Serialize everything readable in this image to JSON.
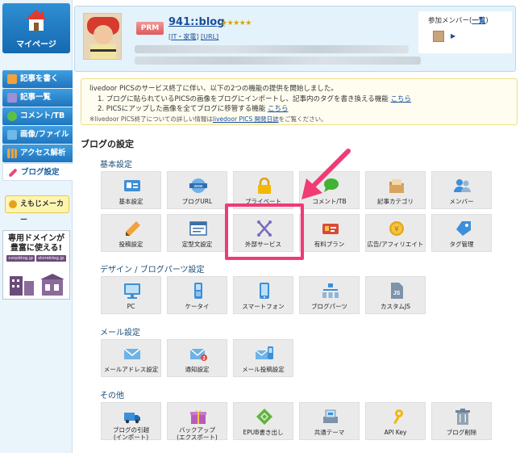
{
  "sidebar": {
    "mypage_label": "マイページ",
    "items": [
      {
        "label": "記事を書く",
        "icon": "pencil-icon",
        "color": "#f2a13b"
      },
      {
        "label": "記事一覧",
        "icon": "document-icon",
        "color": "#9e8fd6"
      },
      {
        "label": "コメント/TB",
        "icon": "chat-bubble-icon",
        "color": "#5cc046"
      },
      {
        "label": "画像/ファイル",
        "icon": "image-icon",
        "color": "#6fb8e8"
      },
      {
        "label": "アクセス解析",
        "icon": "bar-chart-icon",
        "color": "#f2a13b"
      },
      {
        "label": "ブログ設定",
        "icon": "wrench-icon",
        "color": "#e04c7a"
      }
    ],
    "emoji_maker_label": "えもじメーカー",
    "ad": {
      "line1": "専用ドメインが",
      "line2": "豊富に使える!",
      "domain1": "corpblog.jp",
      "domain2": "storeblog.jp"
    }
  },
  "header": {
    "badge": "PRM",
    "blog_name": "941::blog",
    "stars": "★★★★★",
    "category_open": "[",
    "category": "IT・家電",
    "category_close": "]",
    "url_label": "[URL]",
    "members_label": "参加メンバー",
    "members_open": "(",
    "members_link": "一覧",
    "members_close": ")"
  },
  "notice": {
    "line1": "livedoor PICSのサービス終了に伴い、以下の2つの機能の提供を開始しました。",
    "item1": "1. ブログに貼られているPICSの画像をブログにインポートし、記事内のタグを書き換える機能",
    "item1_link": "こちら",
    "item2": "2. PICSにアップした画像を全てブログに移管する機能",
    "item2_link": "こちら",
    "note_pre": "※livedoor PICS終了についての詳しい情報は",
    "note_link": "livedoor PICS 開発日誌",
    "note_post": "をご覧ください。"
  },
  "main": {
    "heading": "ブログの設定",
    "sections": [
      {
        "title": "基本設定",
        "tiles": [
          {
            "label": "基本設定",
            "icon": "id-card-icon"
          },
          {
            "label": "ブログURL",
            "icon": "www-globe-icon"
          },
          {
            "label": "プライベート",
            "icon": "lock-icon"
          },
          {
            "label": "コメント/TB",
            "icon": "chat-bubble-icon"
          },
          {
            "label": "記事カテゴリ",
            "icon": "folder-icon"
          },
          {
            "label": "メンバー",
            "icon": "members-icon"
          },
          {
            "label": "投稿設定",
            "icon": "pencil-icon"
          },
          {
            "label": "定型文設定",
            "icon": "template-icon"
          },
          {
            "label": "外部サービス",
            "icon": "connect-icon"
          },
          {
            "label": "有料プラン",
            "icon": "premium-card-icon"
          },
          {
            "label": "広告/アフィリエイト",
            "icon": "yen-coin-icon"
          },
          {
            "label": "タグ管理",
            "icon": "tag-icon"
          }
        ]
      },
      {
        "title": "デザイン / ブログパーツ設定",
        "tiles": [
          {
            "label": "PC",
            "icon": "monitor-icon"
          },
          {
            "label": "ケータイ",
            "icon": "feature-phone-icon"
          },
          {
            "label": "スマートフォン",
            "icon": "smartphone-icon"
          },
          {
            "label": "ブログパーツ",
            "icon": "blog-parts-icon"
          },
          {
            "label": "カスタムJS",
            "icon": "js-file-icon"
          }
        ]
      },
      {
        "title": "メール設定",
        "tiles": [
          {
            "label": "メールアドレス設定",
            "icon": "mail-icon"
          },
          {
            "label": "通知設定",
            "icon": "mail-notify-icon",
            "badge": "2"
          },
          {
            "label": "メール投稿設定",
            "icon": "mail-phone-icon"
          }
        ]
      },
      {
        "title": "その他",
        "tiles": [
          {
            "label": "ブログの引越\n(インポート)",
            "icon": "moving-truck-icon"
          },
          {
            "label": "バックアップ\n(エクスポート)",
            "icon": "backup-gift-icon"
          },
          {
            "label": "EPUB書き出し",
            "icon": "epub-icon"
          },
          {
            "label": "共通テーマ",
            "icon": "theme-icon"
          },
          {
            "label": "API Key",
            "icon": "key-icon"
          },
          {
            "label": "ブログ削除",
            "icon": "trash-icon"
          }
        ]
      }
    ]
  },
  "colors": {
    "accent_highlight": "#f03b75",
    "nav_blue": "#1f75be",
    "link_blue": "#1a4f9a"
  }
}
